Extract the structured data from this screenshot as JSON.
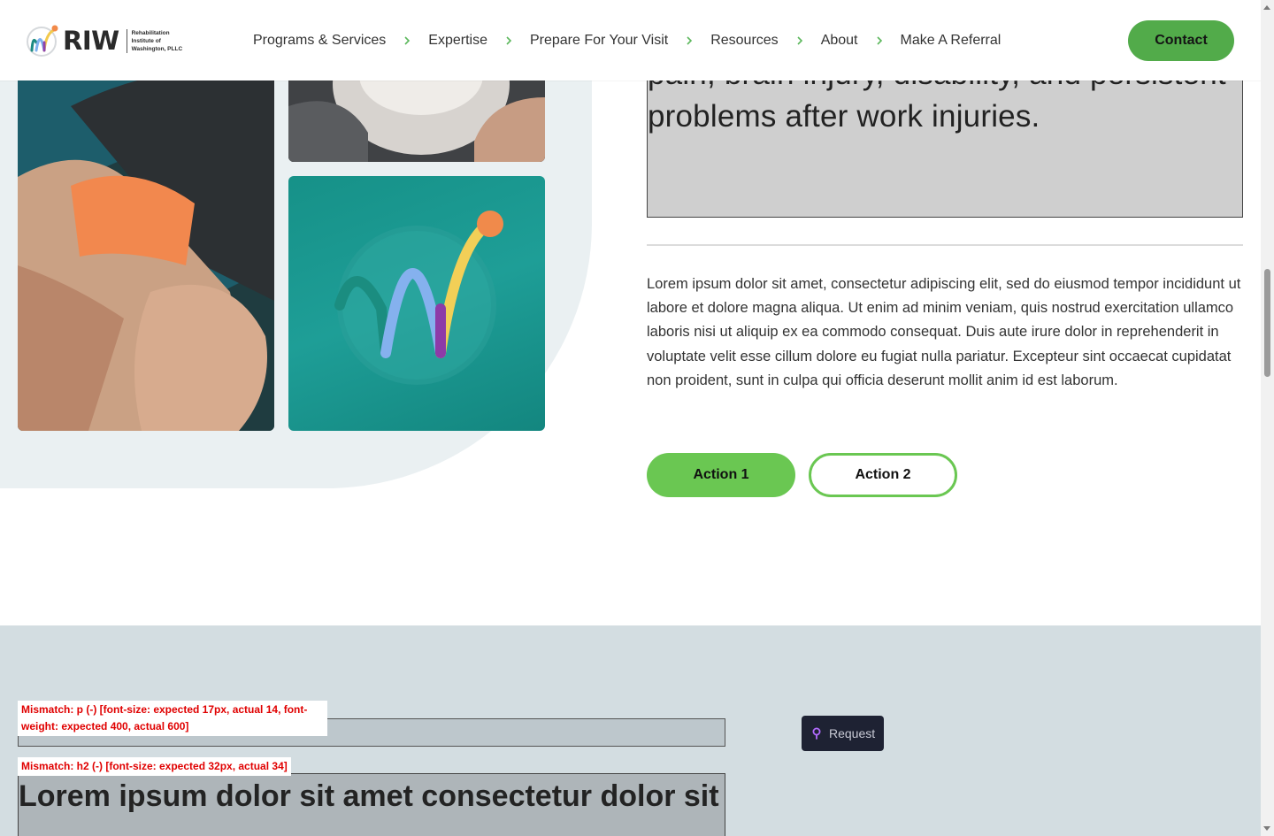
{
  "header": {
    "logo": {
      "name": "RIW",
      "tagline": "Rehabilitation Institute of Washington, PLLC"
    },
    "nav": [
      {
        "label": "Programs & Services"
      },
      {
        "label": "Expertise"
      },
      {
        "label": "Prepare For Your Visit"
      },
      {
        "label": "Resources"
      },
      {
        "label": "About"
      },
      {
        "label": "Make A Referral"
      }
    ],
    "nav_separator_icon": "chevron-right-icon",
    "contact_label": "Contact"
  },
  "hero": {
    "lead_text": "providing integrated cutting-edge treatment options for persons with chronic pain, brain injury, disability, and persistent problems after work injuries.",
    "body_text": "Lorem ipsum dolor sit amet, consectetur adipiscing elit, sed do eiusmod tempor incididunt ut labore et dolore magna aliqua. Ut enim ad minim veniam, quis nostrud exercitation ullamco laboris nisi ut aliquip ex ea commodo consequat. Duis aute irure dolor in reprehenderit in voluptate velit esse cillum dolore eu fugiat nulla pariatur. Excepteur sint occaecat cupidatat non proident, sunt in culpa qui officia deserunt mollit anim id est laborum.",
    "action1_label": "Action 1",
    "action2_label": "Action 2"
  },
  "lower": {
    "p_mismatch": "Mismatch: p (-) [font-size: expected 17px, actual 14, font-weight: expected 400, actual 600]",
    "h2_mismatch": "Mismatch: h2 (-) [font-size: expected 32px, actual 34]",
    "heading": "Lorem ipsum dolor sit amet consectetur dolor sit",
    "request_label": "Request",
    "request_icon": "pin-icon"
  },
  "colors": {
    "accent_green": "#6ac752",
    "contact_green": "#52ab4a",
    "teal": "#169188",
    "error_red": "#e00000",
    "section_bg": "#d3dde1"
  }
}
